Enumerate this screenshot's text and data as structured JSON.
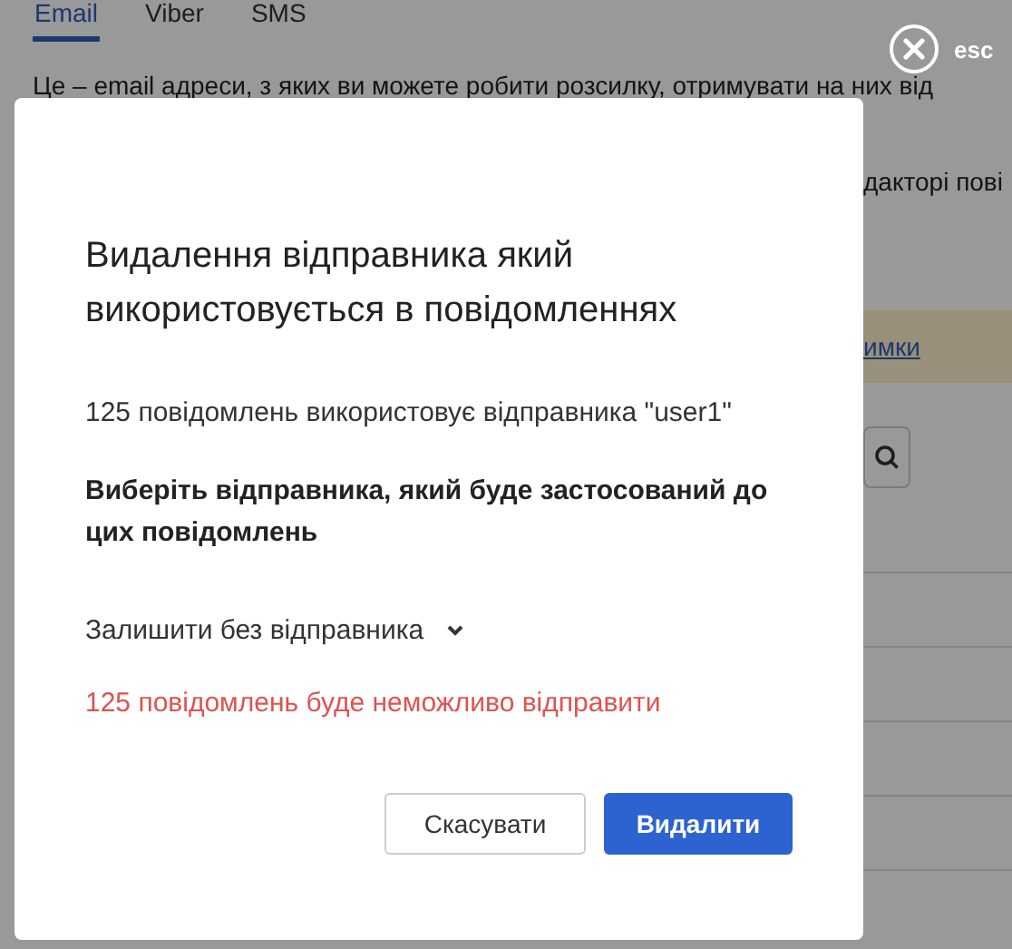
{
  "tabs": [
    {
      "label": "Email",
      "selected": true
    },
    {
      "label": "Viber",
      "selected": false
    },
    {
      "label": "SMS",
      "selected": false
    }
  ],
  "intro": "Це – email адреси, з яких ви можете робити розсилку, отримувати на них від",
  "editor_note": "дакторі пові",
  "banner_link": "имки",
  "close": {
    "label": "esc"
  },
  "modal": {
    "title": "Видалення відправника який використовується в повідомленнях",
    "info": "125 повідомлень використовує відправника \"user1\"",
    "prompt": "Виберіть відправника, який буде застосований до цих повідомлень",
    "select": {
      "value": "Залишити без відправника"
    },
    "warning": "125 повідомлень буде неможливо відправити",
    "buttons": [
      {
        "label": "Скасувати",
        "kind": "secondary"
      },
      {
        "label": "Видалити",
        "kind": "primary"
      }
    ]
  }
}
